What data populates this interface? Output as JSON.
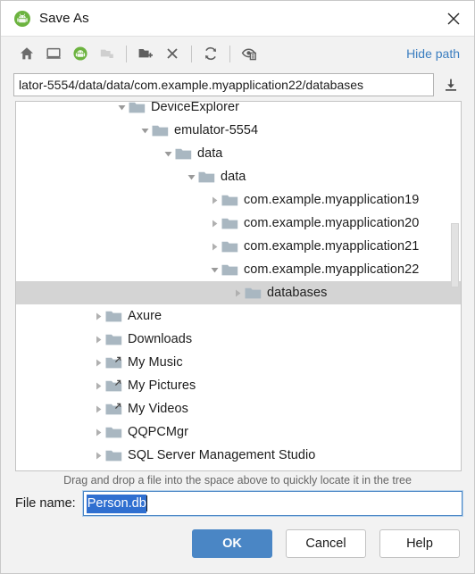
{
  "window": {
    "title": "Save As",
    "icon": "android-studio-icon",
    "close_icon": "close-icon"
  },
  "toolbar": {
    "buttons": [
      {
        "name": "home-icon",
        "tooltip": "Home",
        "disabled": false
      },
      {
        "name": "desktop-icon",
        "tooltip": "Desktop",
        "disabled": false
      },
      {
        "name": "android-device-icon",
        "tooltip": "Android Device",
        "disabled": false
      },
      {
        "name": "project-folder-icon",
        "tooltip": "Project",
        "disabled": true
      },
      {
        "name": "new-folder-icon",
        "tooltip": "New Folder",
        "disabled": false
      },
      {
        "name": "delete-icon",
        "tooltip": "Delete",
        "disabled": false
      },
      {
        "name": "refresh-icon",
        "tooltip": "Refresh",
        "disabled": false
      },
      {
        "name": "show-hidden-files-icon",
        "tooltip": "Show Hidden Files",
        "disabled": false
      }
    ],
    "hide_path_label": "Hide path"
  },
  "path": {
    "value": "lator-5554/data/data/com.example.myapplication22/databases",
    "download_icon": "download-icon"
  },
  "tree": {
    "rows": [
      {
        "label": "DeviceExplorer",
        "depth": 4,
        "state": "expanded",
        "icon": "folder-icon",
        "selected": false,
        "clipped": true
      },
      {
        "label": "emulator-5554",
        "depth": 5,
        "state": "expanded",
        "icon": "folder-icon",
        "selected": false
      },
      {
        "label": "data",
        "depth": 6,
        "state": "expanded",
        "icon": "folder-icon",
        "selected": false
      },
      {
        "label": "data",
        "depth": 7,
        "state": "expanded",
        "icon": "folder-icon",
        "selected": false
      },
      {
        "label": "com.example.myapplication19",
        "depth": 8,
        "state": "collapsed",
        "icon": "folder-icon",
        "selected": false
      },
      {
        "label": "com.example.myapplication20",
        "depth": 8,
        "state": "collapsed",
        "icon": "folder-icon",
        "selected": false
      },
      {
        "label": "com.example.myapplication21",
        "depth": 8,
        "state": "collapsed",
        "icon": "folder-icon",
        "selected": false
      },
      {
        "label": "com.example.myapplication22",
        "depth": 8,
        "state": "expanded",
        "icon": "folder-icon",
        "selected": false
      },
      {
        "label": "databases",
        "depth": 9,
        "state": "collapsed",
        "icon": "folder-icon",
        "selected": true
      },
      {
        "label": "Axure",
        "depth": 3,
        "state": "collapsed",
        "icon": "folder-icon",
        "selected": false
      },
      {
        "label": "Downloads",
        "depth": 3,
        "state": "collapsed",
        "icon": "folder-icon",
        "selected": false
      },
      {
        "label": "My Music",
        "depth": 3,
        "state": "collapsed",
        "icon": "folder-shortcut-icon",
        "selected": false
      },
      {
        "label": "My Pictures",
        "depth": 3,
        "state": "collapsed",
        "icon": "folder-shortcut-icon",
        "selected": false
      },
      {
        "label": "My Videos",
        "depth": 3,
        "state": "collapsed",
        "icon": "folder-shortcut-icon",
        "selected": false
      },
      {
        "label": "QQPCMgr",
        "depth": 3,
        "state": "collapsed",
        "icon": "folder-icon",
        "selected": false
      },
      {
        "label": "SQL Server Management Studio",
        "depth": 3,
        "state": "collapsed",
        "icon": "folder-icon",
        "selected": false
      }
    ]
  },
  "hint": {
    "text": "Drag and drop a file into the space above to quickly locate it in the tree"
  },
  "filename": {
    "label": "File name:",
    "value": "Person.db",
    "selected": true
  },
  "buttons": {
    "ok": "OK",
    "cancel": "Cancel",
    "help": "Help"
  },
  "colors": {
    "accent": "#4a86c5",
    "link": "#3b7ec0",
    "selection": "#2f6fd0",
    "row_selected": "#d4d4d4",
    "folder": "#a9b7c1",
    "android_green": "#6cb33f"
  }
}
